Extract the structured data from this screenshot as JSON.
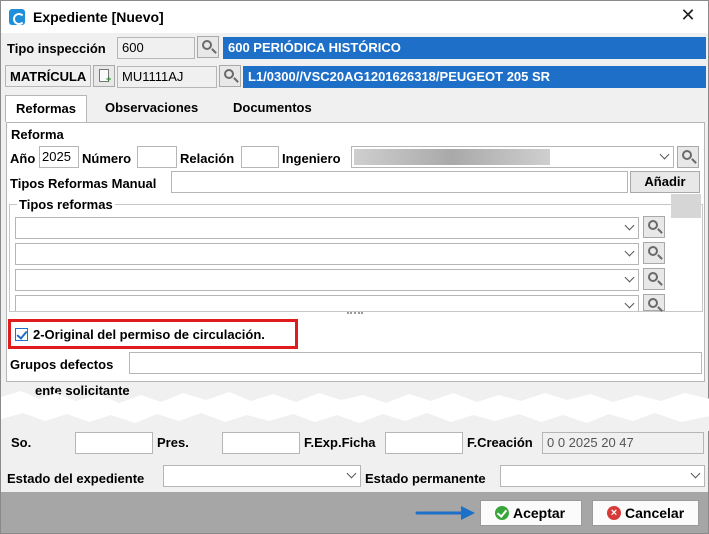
{
  "window": {
    "title": "Expediente [Nuevo]"
  },
  "header": {
    "tipo_label": "Tipo inspección",
    "tipo_code": "600",
    "tipo_desc": "600 PERIÓDICA HISTÓRICO",
    "matricula_label": "MATRÍCULA",
    "matricula_value": "MU1111AJ",
    "vehicle_desc": "L1/0300//VSC20AG1201626318/PEUGEOT 205 SR"
  },
  "tabs": [
    {
      "label": "Reformas",
      "active": true
    },
    {
      "label": "Observaciones",
      "active": false
    },
    {
      "label": "Documentos",
      "active": false
    }
  ],
  "reforma": {
    "group_label": "Reforma",
    "anio_label": "Año",
    "anio_value": "2025",
    "numero_label": "Número",
    "relacion_label": "Relación",
    "ingeniero_label": "Ingeniero",
    "tipos_manual_label": "Tipos Reformas Manual",
    "anadir_label": "Añadir",
    "tipos_group_label": "Tipos reformas"
  },
  "checkbox": {
    "label": "2-Original del permiso de circulación.",
    "checked": true
  },
  "grupos_label": "Grupos defectos",
  "solicitante_label": "ente solicitante",
  "lower_row": {
    "l1": "So.",
    "l2": "Pres.",
    "l3": "F.Exp.Ficha",
    "l4": "F.Creación",
    "creacion_value": "0  0   2025 20  47"
  },
  "estado": {
    "expediente_label": "Estado del expediente",
    "permanente_label": "Estado permanente"
  },
  "footer": {
    "accept_label": "Aceptar",
    "cancel_label": "Cancelar"
  },
  "colors": {
    "accent": "#1e6fc8",
    "highlight_box": "#e01b1b",
    "arrow": "#1e6fc8"
  }
}
